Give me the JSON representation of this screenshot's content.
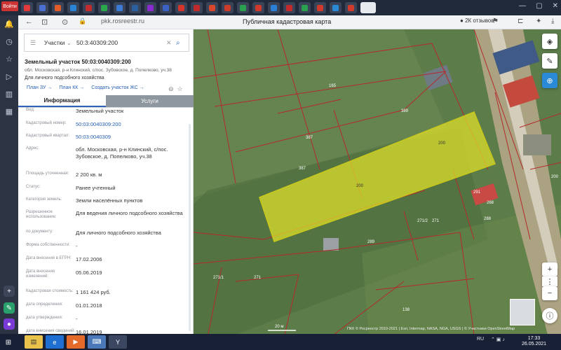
{
  "browser": {
    "exit_label": "Войти",
    "url": "pkk.rosreestr.ru",
    "page_title": "Публичная кадастровая карта",
    "reviews": "2К отзывов",
    "back_icon": "arrow-left-icon",
    "forward_icon": "arrow-right-icon"
  },
  "tabs": {
    "favicons": [
      "y",
      "o",
      "k",
      "o",
      "y",
      "w",
      "y",
      "/",
      "b",
      "m",
      "k",
      "k",
      "k",
      "k",
      "k",
      "k",
      "k",
      "y",
      "k",
      "k",
      "k",
      "y"
    ],
    "colors": [
      "#e23a3a",
      "#4a6fd1",
      "#e25c2a",
      "#2a84d6",
      "#c32c2c",
      "#2aa84a",
      "#3a7bd5",
      "#2a5fa0",
      "#8a2ad0",
      "#3a62c5",
      "#d7352a",
      "#c02a2a",
      "#d8472a",
      "#cc3a2a",
      "#2a9f4e",
      "#d13a2a",
      "#2a7fd6",
      "#c42a2a",
      "#2a9f4e",
      "#d13a2a",
      "#2a8ad6",
      "#d13a2a"
    ]
  },
  "search": {
    "type": "Участки",
    "query": "50:3:40309:200"
  },
  "parcel": {
    "title": "Земельный участок 50:03:0040309:200",
    "address": "обл. Московская, р-н Клинский, с/пос. Зубовское, д. Попелково, уч.38",
    "use": "Для личного подсобного хозяйства",
    "links": [
      "План ЗУ →",
      "План КК →",
      "Создать участок ЖС →"
    ]
  },
  "info_tabs": [
    "Информация",
    "Услуги"
  ],
  "fields": [
    {
      "label": "Вид:",
      "value": "Земельный участок",
      "link": false
    },
    {
      "label": "Кадастровый номер:",
      "value": "50:03:0040309:200",
      "link": true
    },
    {
      "label": "Кадастровый квартал:",
      "value": "50:03:0040309",
      "link": true
    },
    {
      "label": "Адрес:",
      "value": "обл. Московская, р-н Клинский, с/пос. Зубовское, д. Попелково, уч.38",
      "link": false
    },
    {
      "label": "Площадь уточненная:",
      "value": "2 200 кв. м",
      "link": false
    },
    {
      "label": "Статус:",
      "value": "Ранее учтенный",
      "link": false
    },
    {
      "label": "Категория земель:",
      "value": "Земли населённых пунктов",
      "link": false
    },
    {
      "label": "Разрешенное использование:",
      "value": "Для ведения личного подсобного хозяйства",
      "link": false
    },
    {
      "label": "по документу:",
      "value": "Для личного подсобного хозяйства",
      "link": false
    },
    {
      "label": "Форма собственности:",
      "value": "-",
      "link": false
    },
    {
      "label": "Дата внесения в ЕГРН:",
      "value": "17.02.2006",
      "link": false
    },
    {
      "label": "Дата внесения изменений:",
      "value": "05.06.2019",
      "link": false
    },
    {
      "label": "Кадастровая стоимость:",
      "value": "1 161 424 руб.",
      "link": false
    },
    {
      "label": "дата определения:",
      "value": "01.01.2018",
      "link": false
    },
    {
      "label": "дата утверждения:",
      "value": "-",
      "link": false
    },
    {
      "label": "дата внесения сведений:",
      "value": "16.01.2019",
      "link": false
    }
  ],
  "map": {
    "parcel_labels": [
      "165",
      "389",
      "387",
      "200",
      "200",
      "387",
      "291",
      "288",
      "268",
      "271/2",
      "271",
      "289",
      "271/1",
      "271",
      "138",
      "200"
    ],
    "scale": "20 м",
    "attribution": "ПКК © Росреестр 2010-2021 | Esri, Intermap, NASA, NGA, USGS | © Участники OpenStreetMap",
    "controls": [
      "layers-icon",
      "ruler-icon",
      "target-icon",
      "plus-icon",
      "more-icon",
      "minus-icon",
      "info-icon"
    ],
    "highlight_color": "#e2e22a"
  },
  "taskbar": {
    "lang": "RU",
    "time": "17:33",
    "date": "26.05.2021"
  }
}
